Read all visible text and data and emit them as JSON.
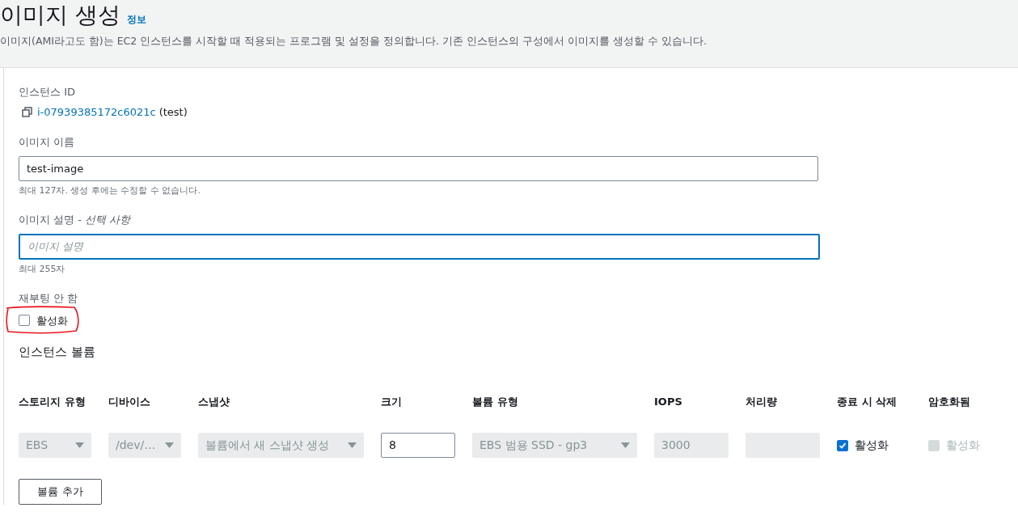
{
  "header": {
    "title": "이미지 생성",
    "info_link": "정보",
    "description": "이미지(AMI라고도 함)는 EC2 인스턴스를 시작할 때 적용되는 프로그램 및 설정을 정의합니다. 기존 인스턴스의 구성에서 이미지를 생성할 수 있습니다."
  },
  "instance_id": {
    "label": "인스턴스 ID",
    "id": "i-07939385172c6021c",
    "name": "(test)"
  },
  "image_name": {
    "label": "이미지 이름",
    "value": "test-image",
    "hint": "최대 127자. 생성 후에는 수정할 수 없습니다."
  },
  "image_description": {
    "label": "이미지 설명 - ",
    "label_optional": "선택 사항",
    "placeholder": "이미지 설명",
    "focused": true,
    "hint": "최대 255자"
  },
  "no_reboot": {
    "label": "재부팅 안 함",
    "option": "활성화",
    "checked": false,
    "annotated": true
  },
  "volumes": {
    "title": "인스턴스 볼륨",
    "columns": [
      "스토리지 유형",
      "디바이스",
      "스냅샷",
      "크기",
      "볼륨 유형",
      "IOPS",
      "처리량",
      "종료 시 삭제",
      "암호화됨"
    ],
    "rows": [
      {
        "cells": [
          {
            "kind": "select",
            "value": "EBS",
            "disabled": true
          },
          {
            "kind": "select",
            "value": "/dev/…",
            "disabled": true
          },
          {
            "kind": "select",
            "value": "볼륨에서 새 스냅샷 생성",
            "disabled": true
          },
          {
            "kind": "input",
            "value": "8",
            "disabled": false
          },
          {
            "kind": "select",
            "value": "EBS 범용 SSD - gp3",
            "disabled": true
          },
          {
            "kind": "input",
            "value": "3000",
            "disabled": true
          },
          {
            "kind": "input",
            "disabled": true
          },
          {
            "kind": "checkbox",
            "value": "활성화",
            "checked": true,
            "disabled": false
          },
          {
            "kind": "checkbox",
            "value": "활성화",
            "checked": false,
            "disabled": true
          }
        ]
      }
    ]
  },
  "add_volume_button": "볼륨 추가"
}
